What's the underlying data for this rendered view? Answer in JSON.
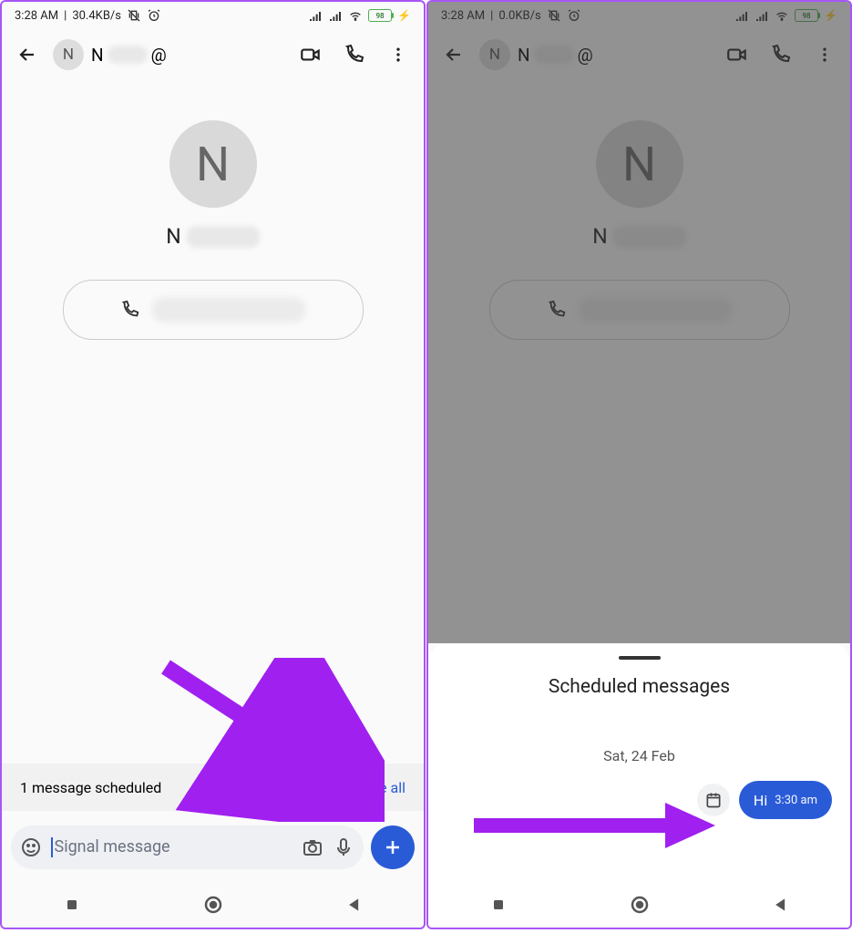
{
  "left": {
    "status": {
      "time": "3:28 AM",
      "net": "30.4KB/s",
      "battery": "98"
    },
    "header": {
      "avatar_initial": "N",
      "title_initial": "N",
      "at_symbol": "@"
    },
    "profile": {
      "avatar_initial": "N",
      "name_initial": "N"
    },
    "scheduled_banner": {
      "count_text": "1 message scheduled",
      "see_all": "See all"
    },
    "composer": {
      "placeholder": "Signal message"
    }
  },
  "right": {
    "status": {
      "time": "3:28 AM",
      "net": "0.0KB/s",
      "battery": "98"
    },
    "header": {
      "avatar_initial": "N",
      "title_initial": "N",
      "at_symbol": "@"
    },
    "profile": {
      "avatar_initial": "N",
      "name_initial": "N"
    },
    "sheet": {
      "title": "Scheduled messages",
      "date": "Sat, 24 Feb",
      "message_text": "Hi",
      "message_time": "3:30 am"
    }
  }
}
